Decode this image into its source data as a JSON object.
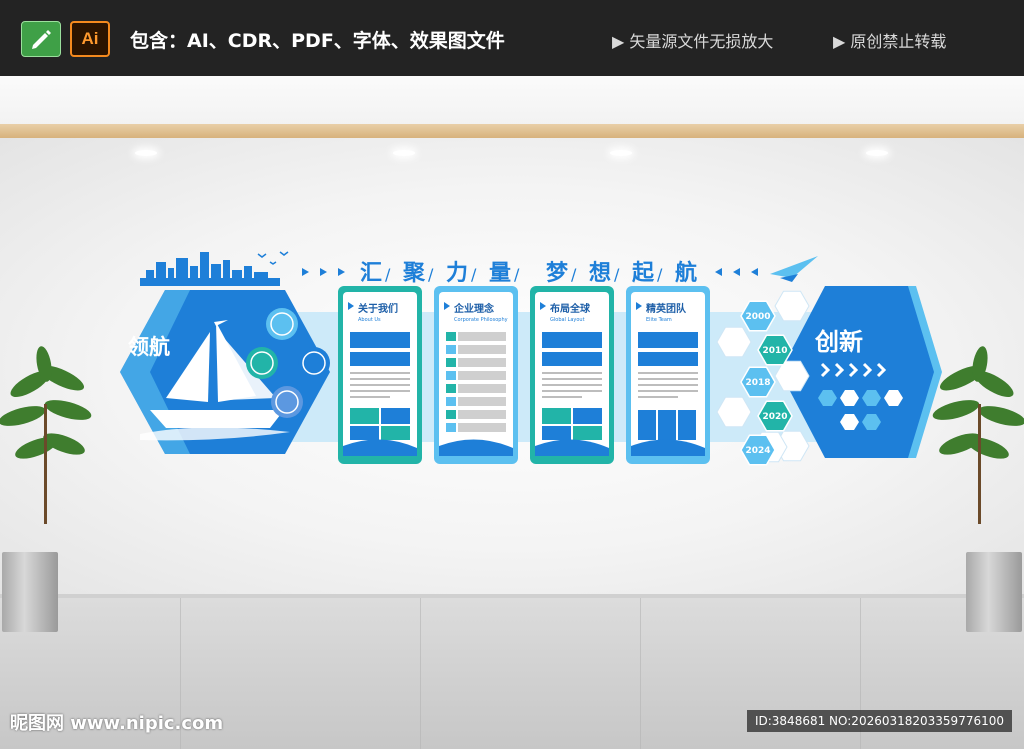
{
  "topbar": {
    "ai_label": "Ai",
    "contains": "包含：AI、CDR、PDF、字体、效果图文件",
    "note_vector": "▶ 矢量源文件无损放大",
    "note_original": "▶ 原创禁止转载"
  },
  "wall": {
    "slogan": [
      "汇",
      "聚",
      "力",
      "量",
      "梦",
      "想",
      "起",
      "航"
    ],
    "left_title": "领航",
    "right_title": "创新",
    "panels": [
      {
        "title": "关于我们",
        "subtitle": "About Us"
      },
      {
        "title": "企业理念",
        "subtitle": "Corporate Philosophy"
      },
      {
        "title": "布局全球",
        "subtitle": "Global Layout"
      },
      {
        "title": "精英团队",
        "subtitle": "Elite Team"
      }
    ],
    "years": [
      "2000",
      "2010",
      "2018",
      "2020",
      "2024"
    ]
  },
  "colors": {
    "primary": "#1e7fd8",
    "light_blue": "#5cc0f0",
    "teal": "#22b4a8",
    "banner": "#232323"
  },
  "footer": {
    "watermark": "昵图网 www.nipic.com",
    "id_text": "ID:3848681 NO:20260318203359776100"
  }
}
